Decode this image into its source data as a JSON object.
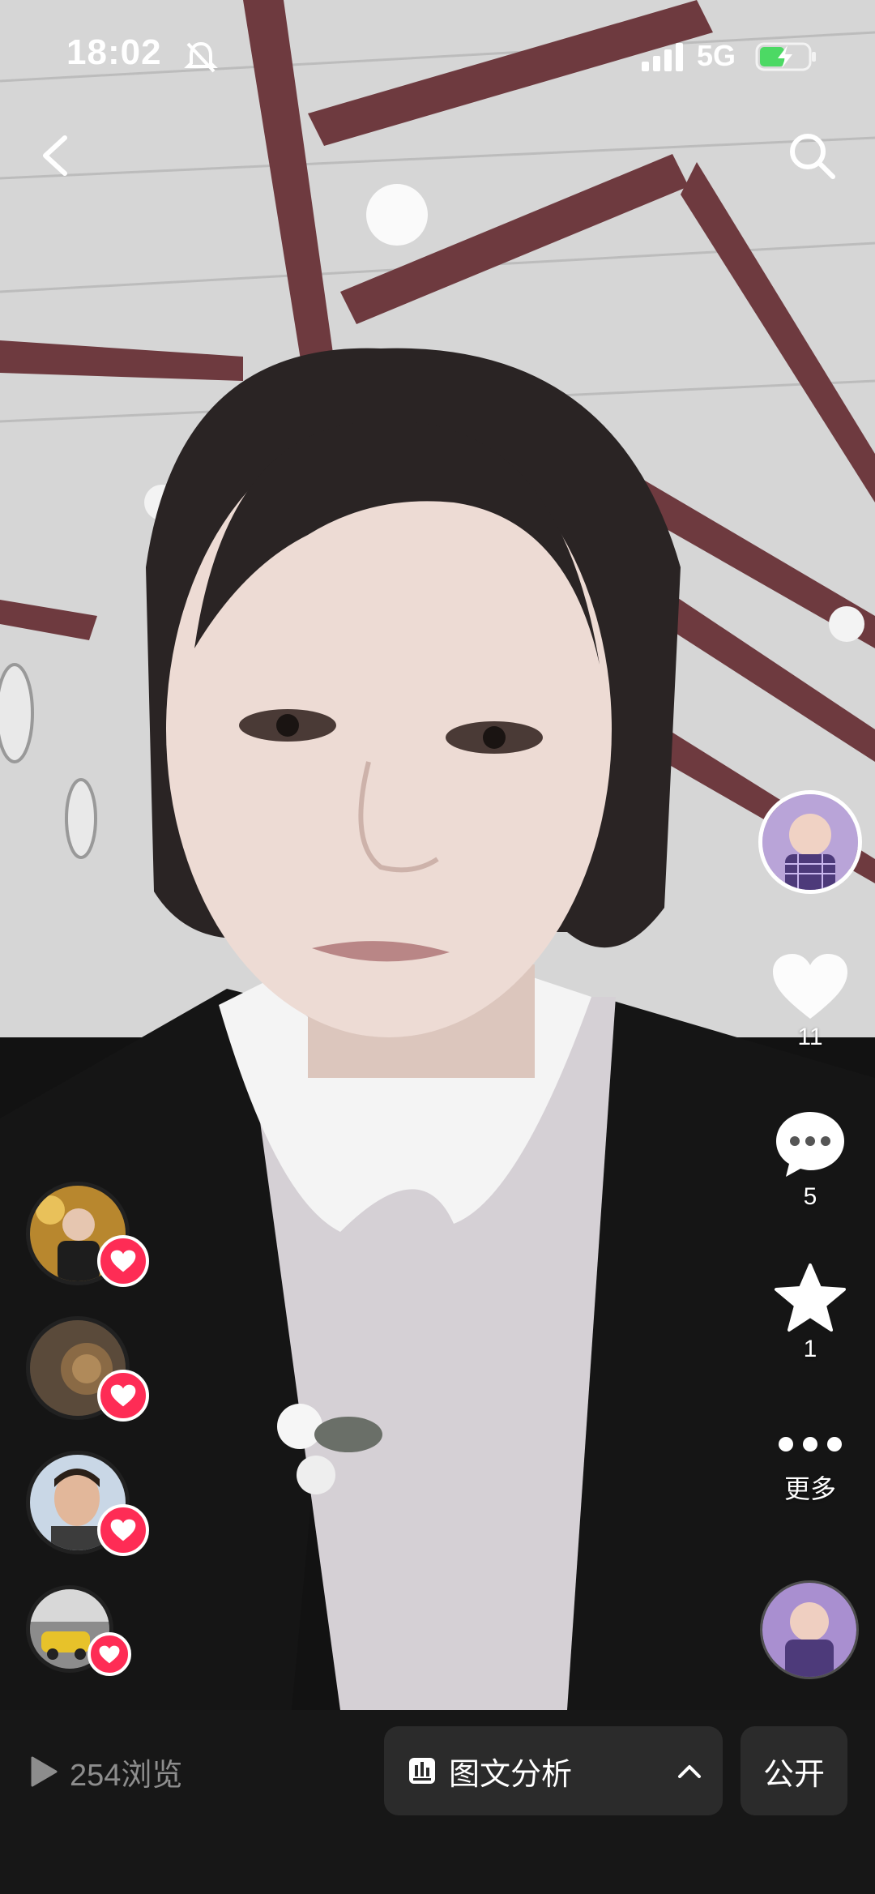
{
  "status_bar": {
    "time": "18:02",
    "network": "5G"
  },
  "icons": {
    "back": "chevron-left-icon",
    "search": "search-icon",
    "like": "heart-icon",
    "comment": "comment-bubble-icon",
    "favorite": "star-icon",
    "more": "ellipsis-icon",
    "views": "play-icon",
    "analysis": "bar-chart-icon",
    "expand": "chevron-up-icon"
  },
  "actions": {
    "like_count": "11",
    "comment_count": "5",
    "favorite_count": "1",
    "more_label": "更多"
  },
  "bottom_bar": {
    "views_label": "254浏览",
    "analysis_label": "图文分析",
    "visibility_label": "公开"
  },
  "colors": {
    "accent_red": "#fe2c55",
    "bar_bg": "#171717",
    "button_bg": "#2b2b2b",
    "views_text": "#8d8d8d"
  }
}
